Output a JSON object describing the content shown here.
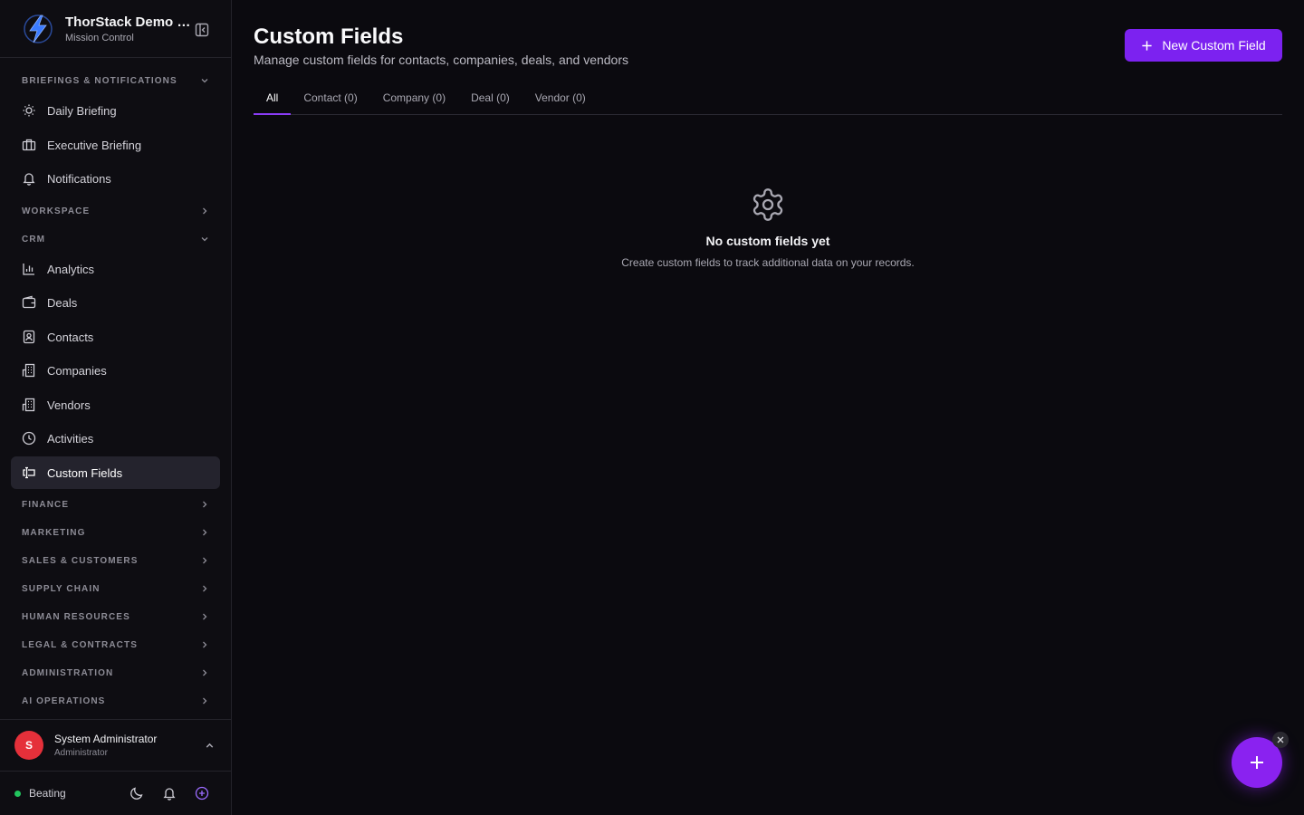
{
  "brand": {
    "title": "ThorStack Demo C...",
    "subtitle": "Mission Control"
  },
  "sidebar": {
    "sections": [
      {
        "label": "BRIEFINGS & NOTIFICATIONS",
        "state": "expanded"
      },
      {
        "label": "WORKSPACE",
        "state": "collapsed"
      },
      {
        "label": "CRM",
        "state": "expanded"
      },
      {
        "label": "FINANCE",
        "state": "collapsed"
      },
      {
        "label": "MARKETING",
        "state": "collapsed"
      },
      {
        "label": "SALES & CUSTOMERS",
        "state": "collapsed"
      },
      {
        "label": "SUPPLY CHAIN",
        "state": "collapsed"
      },
      {
        "label": "HUMAN RESOURCES",
        "state": "collapsed"
      },
      {
        "label": "LEGAL & CONTRACTS",
        "state": "collapsed"
      },
      {
        "label": "ADMINISTRATION",
        "state": "collapsed"
      },
      {
        "label": "AI OPERATIONS",
        "state": "collapsed"
      }
    ],
    "items": [
      {
        "label": "Daily Briefing",
        "icon": "sun-icon"
      },
      {
        "label": "Executive Briefing",
        "icon": "briefcase-icon"
      },
      {
        "label": "Notifications",
        "icon": "bell-icon"
      },
      {
        "label": "Analytics",
        "icon": "bar-chart-icon"
      },
      {
        "label": "Deals",
        "icon": "wallet-icon"
      },
      {
        "label": "Contacts",
        "icon": "contact-card-icon"
      },
      {
        "label": "Companies",
        "icon": "building-icon"
      },
      {
        "label": "Vendors",
        "icon": "building-icon"
      },
      {
        "label": "Activities",
        "icon": "clock-icon"
      },
      {
        "label": "Custom Fields",
        "icon": "form-input-icon",
        "active": true
      }
    ]
  },
  "user": {
    "initial": "S",
    "name": "System Administrator",
    "role": "Administrator"
  },
  "footer": {
    "status": "Beating",
    "status_color": "#22c55e"
  },
  "page": {
    "title": "Custom Fields",
    "description": "Manage custom fields for contacts, companies, deals, and vendors",
    "new_button": "New Custom Field",
    "tabs": [
      "All",
      "Contact (0)",
      "Company (0)",
      "Deal (0)",
      "Vendor (0)"
    ],
    "active_tab": "All"
  },
  "empty_state": {
    "icon": "gear-icon",
    "title": "No custom fields yet",
    "description": "Create custom fields to track additional data on your records."
  },
  "colors": {
    "accent": "#7c22f0",
    "background": "#0b0a0f",
    "sidebar": "#0e0d12",
    "avatar": "#e5303a"
  }
}
